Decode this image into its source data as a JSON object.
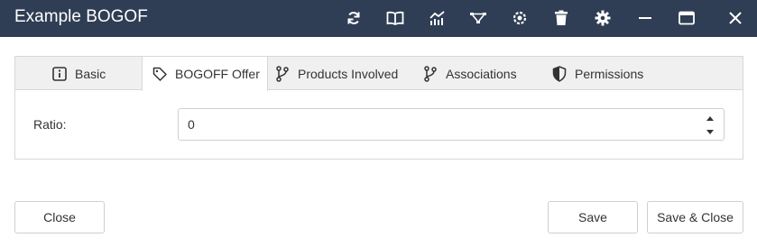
{
  "window": {
    "title": "Example BOGOF",
    "titlebar_color": "#2f3e54",
    "toolbar_icons": [
      "refresh-icon",
      "book-icon",
      "chart-icon",
      "workflow-icon",
      "settings-gear-icon",
      "trash-icon",
      "gear-icon",
      "minimize-icon",
      "maximize-icon",
      "close-icon"
    ]
  },
  "tabs": [
    {
      "label": "Basic",
      "icon": "info-icon",
      "active": false
    },
    {
      "label": "BOGOFF Offer",
      "icon": "tag-icon",
      "active": true
    },
    {
      "label": "Products Involved",
      "icon": "branch-icon",
      "active": false
    },
    {
      "label": "Associations",
      "icon": "branch-icon",
      "active": false
    },
    {
      "label": "Permissions",
      "icon": "shield-icon",
      "active": false
    }
  ],
  "form": {
    "ratio_label": "Ratio:",
    "ratio_value": "0"
  },
  "footer": {
    "close_label": "Close",
    "save_label": "Save",
    "save_close_label": "Save & Close"
  }
}
